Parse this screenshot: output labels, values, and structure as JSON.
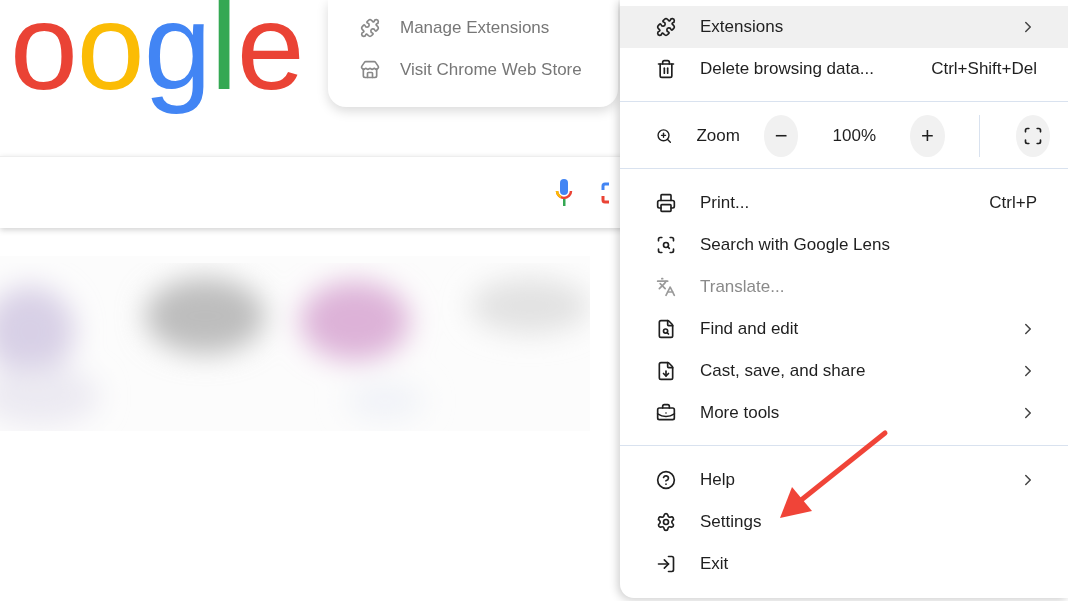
{
  "page": {
    "logo": "oogle"
  },
  "extensions_submenu": {
    "items": [
      {
        "label": "Manage Extensions"
      },
      {
        "label": "Visit Chrome Web Store"
      }
    ]
  },
  "menu": {
    "sections": [
      [
        {
          "kind": "command",
          "label": "Extensions",
          "has_submenu": true,
          "selected": true,
          "disabled": false
        },
        {
          "kind": "command",
          "label": "Delete browsing data...",
          "shortcut": "Ctrl+Shift+Del",
          "has_submenu": false,
          "selected": false,
          "disabled": false
        }
      ],
      [
        {
          "kind": "zoom",
          "label": "Zoom",
          "minus": "−",
          "value": "100%",
          "plus": "+"
        }
      ],
      [
        {
          "kind": "command",
          "label": "Print...",
          "shortcut": "Ctrl+P",
          "has_submenu": false,
          "selected": false,
          "disabled": false
        },
        {
          "kind": "command",
          "label": "Search with Google Lens",
          "has_submenu": false,
          "selected": false,
          "disabled": false
        },
        {
          "kind": "command",
          "label": "Translate...",
          "has_submenu": false,
          "selected": false,
          "disabled": true
        },
        {
          "kind": "command",
          "label": "Find and edit",
          "has_submenu": true,
          "selected": false,
          "disabled": false
        },
        {
          "kind": "command",
          "label": "Cast, save, and share",
          "has_submenu": true,
          "selected": false,
          "disabled": false
        },
        {
          "kind": "command",
          "label": "More tools",
          "has_submenu": true,
          "selected": false,
          "disabled": false
        }
      ],
      [
        {
          "kind": "command",
          "label": "Help",
          "has_submenu": true,
          "selected": false,
          "disabled": false
        },
        {
          "kind": "command",
          "label": "Settings",
          "has_submenu": false,
          "selected": false,
          "disabled": false
        },
        {
          "kind": "command",
          "label": "Exit",
          "has_submenu": false,
          "selected": false,
          "disabled": false
        }
      ]
    ]
  }
}
